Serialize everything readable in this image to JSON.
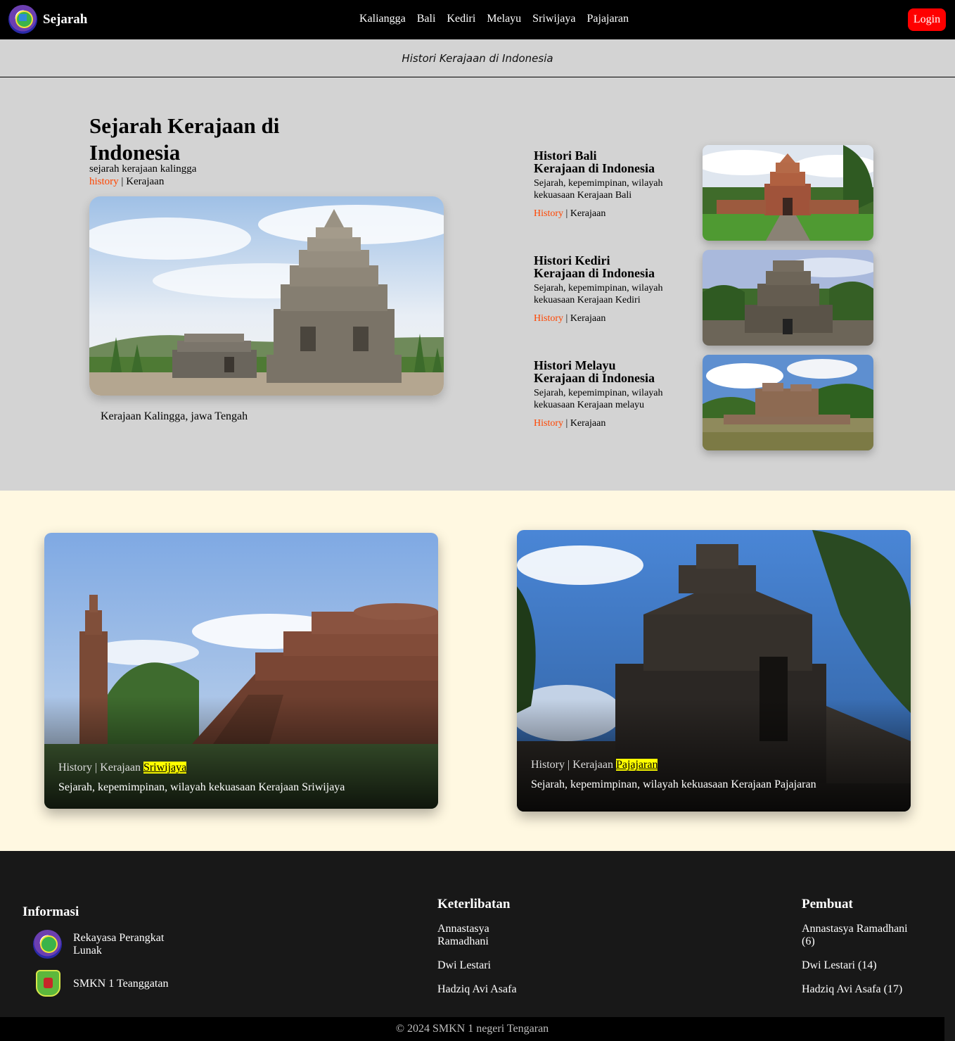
{
  "navbar": {
    "brand": "Sejarah",
    "links": [
      "Kaliangga",
      "Bali",
      "Kediri",
      "Melayu",
      "Sriwijaya",
      "Pajajaran"
    ],
    "login": "Login"
  },
  "subheader": "Histori Kerajaan di Indonesia",
  "hero": {
    "title": "Sejarah Kerajaan di Indonesia",
    "subtitle": "sejarah kerajaan kalingga",
    "tag_history": "history",
    "tag_sep": " | ",
    "tag_kerajaan": "Kerajaan",
    "caption": "Kerajaan Kalingga, jawa Tengah"
  },
  "side_items": [
    {
      "title_1": "Histori Bali",
      "title_2": "Kerajaan di Indonesia",
      "desc": "Sejarah, kepemimpinan, wilayah kekuasaan Kerajaan Bali",
      "history": "History",
      "sep": " | ",
      "kerajaan": "Kerajaan"
    },
    {
      "title_1": "Histori Kediri",
      "title_2": "Kerajaan di Indonesia",
      "desc": "Sejarah, kepemimpinan, wilayah kekuasaan Kerajaan Kediri",
      "history": "History",
      "sep": " | ",
      "kerajaan": "Kerajaan"
    },
    {
      "title_1": "Histori Melayu",
      "title_2": "Kerajaan di Indonesia",
      "desc": "Sejarah, kepemimpinan, wilayah kekuasaan Kerajaan melayu",
      "history": "History",
      "sep": " | ",
      "kerajaan": "Kerajaan"
    }
  ],
  "cards": [
    {
      "prefix": "History | Kerajaan ",
      "highlight": "Sriwijaya",
      "desc": "Sejarah, kepemimpinan, wilayah kekuasaan Kerajaan Sriwijaya"
    },
    {
      "prefix": "History | Kerajaan ",
      "highlight": "Pajajaran",
      "desc": "Sejarah, kepemimpinan, wilayah kekuasaan Kerajaan Pajajaran"
    }
  ],
  "footer": {
    "informasi": {
      "heading": "Informasi",
      "items": [
        "Rekayasa Perangkat Lunak",
        "SMKN 1 Teanggatan"
      ]
    },
    "keterlibatan": {
      "heading": "Keterlibatan",
      "items": [
        "Annastasya Ramadhani",
        "Dwi Lestari",
        "Hadziq Avi Asafa"
      ]
    },
    "pembuat": {
      "heading": "Pembuat",
      "items": [
        "Annastasya Ramadhani (6)",
        "Dwi Lestari (14)",
        "Hadziq Avi Asafa (17)"
      ]
    },
    "copyright": "© 2024 SMKN 1 negeri Tengaran"
  }
}
